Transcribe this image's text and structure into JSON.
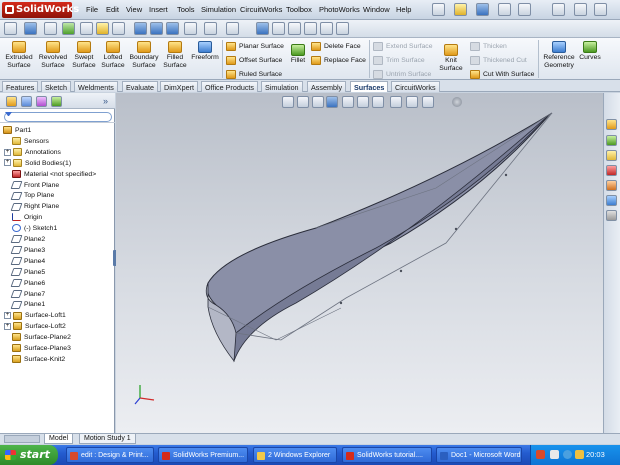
{
  "app": {
    "logo_text": "SolidWorks",
    "menus": [
      "File",
      "Edit",
      "View",
      "Insert",
      "Tools",
      "Simulation",
      "CircuitWorks",
      "Toolbox",
      "PhotoWorks",
      "Window",
      "Help"
    ]
  },
  "command_manager": {
    "big_buttons": [
      {
        "label": "Extruded\nSurface",
        "icon": "extruded-surface-icon"
      },
      {
        "label": "Revolved\nSurface",
        "icon": "revolved-surface-icon"
      },
      {
        "label": "Swept\nSurface",
        "icon": "swept-surface-icon"
      },
      {
        "label": "Lofted\nSurface",
        "icon": "lofted-surface-icon"
      },
      {
        "label": "Boundary\nSurface",
        "icon": "boundary-surface-icon"
      },
      {
        "label": "Filled\nSurface",
        "icon": "filled-surface-icon"
      },
      {
        "label": "Freeform",
        "icon": "freeform-icon"
      }
    ],
    "col_a": [
      "Planar Surface",
      "Offset Surface",
      "Ruled Surface"
    ],
    "fillet": "Fillet",
    "col_b": [
      "Delete Face",
      "Replace Face"
    ],
    "col_c": [
      "Extend Surface",
      "Trim Surface",
      "Untrim Surface"
    ],
    "knit": "Knit\nSurface",
    "col_d": [
      "Thicken",
      "Thickened Cut",
      "Cut With Surface"
    ],
    "reference_geometry": "Reference\nGeometry",
    "curves": "Curves"
  },
  "tabs": [
    "Features",
    "Sketch",
    "Weldments",
    "Evaluate",
    "DimXpert",
    "Office Products",
    "Simulation",
    "Assembly",
    "Surfaces",
    "CircuitWorks"
  ],
  "active_tab": "Surfaces",
  "feature_tree": [
    {
      "label": "Part1",
      "icon": "part",
      "indent": 0,
      "expander": false
    },
    {
      "label": "Sensors",
      "icon": "folder",
      "indent": 1,
      "expander": false
    },
    {
      "label": "Annotations",
      "icon": "folder",
      "indent": 1,
      "expander": true
    },
    {
      "label": "Solid Bodies(1)",
      "icon": "folder",
      "indent": 1,
      "expander": true
    },
    {
      "label": "Material <not specified>",
      "icon": "mat",
      "indent": 1,
      "expander": false
    },
    {
      "label": "Front Plane",
      "icon": "plane",
      "indent": 1,
      "expander": false
    },
    {
      "label": "Top Plane",
      "icon": "plane",
      "indent": 1,
      "expander": false
    },
    {
      "label": "Right Plane",
      "icon": "plane",
      "indent": 1,
      "expander": false
    },
    {
      "label": "Origin",
      "icon": "origin",
      "indent": 1,
      "expander": false
    },
    {
      "label": "(-) Sketch1",
      "icon": "sketch",
      "indent": 1,
      "expander": false
    },
    {
      "label": "Plane2",
      "icon": "plane",
      "indent": 1,
      "expander": false
    },
    {
      "label": "Plane3",
      "icon": "plane",
      "indent": 1,
      "expander": false
    },
    {
      "label": "Plane4",
      "icon": "plane",
      "indent": 1,
      "expander": false
    },
    {
      "label": "Plane5",
      "icon": "plane",
      "indent": 1,
      "expander": false
    },
    {
      "label": "Plane6",
      "icon": "plane",
      "indent": 1,
      "expander": false
    },
    {
      "label": "Plane7",
      "icon": "plane",
      "indent": 1,
      "expander": false
    },
    {
      "label": "Plane1",
      "icon": "plane",
      "indent": 1,
      "expander": false
    },
    {
      "label": "Surface-Loft1",
      "icon": "surf",
      "indent": 1,
      "expander": true
    },
    {
      "label": "Surface-Loft2",
      "icon": "surf",
      "indent": 1,
      "expander": true
    },
    {
      "label": "Surface-Plane2",
      "icon": "surf",
      "indent": 1,
      "expander": false
    },
    {
      "label": "Surface-Plane3",
      "icon": "surf",
      "indent": 1,
      "expander": false
    },
    {
      "label": "Surface-Knit2",
      "icon": "surf",
      "indent": 1,
      "expander": false
    }
  ],
  "bottom_tabs": [
    "Model",
    "Motion Study 1"
  ],
  "taskbar": {
    "start": "start",
    "tasks": [
      {
        "label": "edit : Design & Print...",
        "color": "#d84a2a"
      },
      {
        "label": "SolidWorks Premium...",
        "color": "#d52a1a"
      },
      {
        "label": "2 Windows Explorer",
        "color": "#f2c94a"
      },
      {
        "label": "SolidWorks tutorial....",
        "color": "#d52a1a"
      },
      {
        "label": "Doc1 - Microsoft Word",
        "color": "#2b5fc0"
      }
    ],
    "clock": "20:03"
  },
  "colors": {
    "accent": "#3b72bf",
    "brand": "#d52a1a",
    "taskbar": "#245ccf"
  }
}
